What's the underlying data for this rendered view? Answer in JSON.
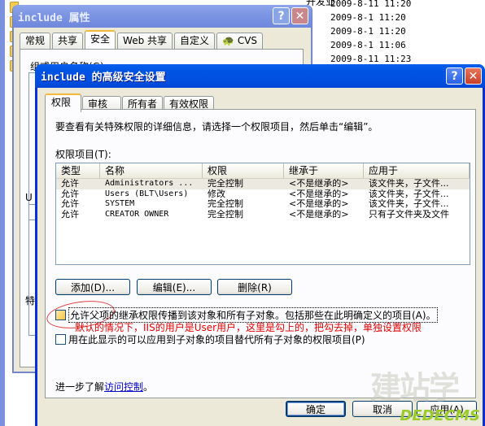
{
  "explorer": {
    "top_text": "开发业",
    "dates": [
      "2009-8-11 11:20",
      "2009-8-1 11:20",
      "2009-8-1 11:20",
      "2009-8-1 11:06",
      "2009-8-11 11:23"
    ]
  },
  "properties_window": {
    "title": "include 属性",
    "tabs": [
      "常规",
      "共享",
      "安全",
      "Web 共享",
      "自定义",
      "CVS"
    ],
    "active_tab": "安全",
    "group_label": "组或用户名称(G):",
    "u_label": "U",
    "t_label": "特"
  },
  "dialog": {
    "title": "include 的高级安全设置",
    "help_label": "?",
    "close_label": "✕",
    "tabs": [
      "权限",
      "审核",
      "所有者",
      "有效权限"
    ],
    "active_tab": "权限",
    "intro": "要查看有关特殊权限的详细信息，请选择一个权限项目，然后单击“编辑”。",
    "perm_label": "权限项目",
    "perm_label_key": "(T):",
    "columns": [
      "类型",
      "名称",
      "权限",
      "继承于",
      "应用于"
    ],
    "rows": [
      {
        "type": "允许",
        "name": "Administrators ...",
        "perm": "完全控制",
        "inherit": "<不是继承的>",
        "apply": "该文件夹，子文件..."
      },
      {
        "type": "允许",
        "name": "Users (BLT\\Users)",
        "perm": "修改",
        "inherit": "<不是继承的>",
        "apply": "该文件夹，子文件..."
      },
      {
        "type": "允许",
        "name": "SYSTEM",
        "perm": "完全控制",
        "inherit": "<不是继承的>",
        "apply": "该文件夹，子文件..."
      },
      {
        "type": "允许",
        "name": "CREATOR OWNER",
        "perm": "完全控制",
        "inherit": "<不是继承的>",
        "apply": "只有子文件夹及文件"
      }
    ],
    "selected_row": 0,
    "buttons": {
      "add": "添加(D)...",
      "edit": "编辑(E)...",
      "remove": "删除(R)"
    },
    "checkbox_inherit": {
      "label": "允许父项的继承权限传播到该对象和所有子对象。包括那些在此明确定义的项目(A)。",
      "checked": false
    },
    "annotation": "默认的情况下，IIS的用户是User用户，这里是勾上的，把勾去掉，单独设置权限",
    "checkbox_replace": {
      "label": "用在此显示的可以应用到子对象的项目替代所有子对象的权限项目(P)",
      "checked": false
    },
    "learn_prefix": "进一步了解",
    "learn_link": "访问控制",
    "learn_suffix": "。",
    "ok": "确定",
    "cancel": "取消",
    "apply": "应用(A)"
  },
  "watermark": {
    "main": "建站学",
    "sub": "DEDECMS"
  }
}
